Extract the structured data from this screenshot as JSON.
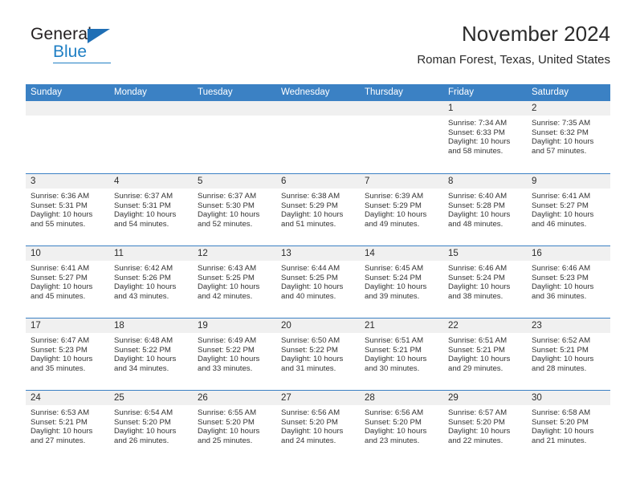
{
  "brand": {
    "name_top": "General",
    "name_bottom": "Blue",
    "accent_color": "#1f7fc4",
    "triangle_color": "#1f6fb5",
    "logo_icon": "triangle-logo-icon"
  },
  "header": {
    "title": "November 2024",
    "subtitle": "Roman Forest, Texas, United States"
  },
  "calendar": {
    "header_bg": "#3b81c4",
    "header_text_color": "#ffffff",
    "day_head_bg": "#f0f0f0",
    "weekdays": [
      "Sunday",
      "Monday",
      "Tuesday",
      "Wednesday",
      "Thursday",
      "Friday",
      "Saturday"
    ],
    "weeks": [
      [
        {
          "day": "",
          "lines": []
        },
        {
          "day": "",
          "lines": []
        },
        {
          "day": "",
          "lines": []
        },
        {
          "day": "",
          "lines": []
        },
        {
          "day": "",
          "lines": []
        },
        {
          "day": "1",
          "lines": [
            "Sunrise: 7:34 AM",
            "Sunset: 6:33 PM",
            "Daylight: 10 hours",
            "and 58 minutes."
          ]
        },
        {
          "day": "2",
          "lines": [
            "Sunrise: 7:35 AM",
            "Sunset: 6:32 PM",
            "Daylight: 10 hours",
            "and 57 minutes."
          ]
        }
      ],
      [
        {
          "day": "3",
          "lines": [
            "Sunrise: 6:36 AM",
            "Sunset: 5:31 PM",
            "Daylight: 10 hours",
            "and 55 minutes."
          ]
        },
        {
          "day": "4",
          "lines": [
            "Sunrise: 6:37 AM",
            "Sunset: 5:31 PM",
            "Daylight: 10 hours",
            "and 54 minutes."
          ]
        },
        {
          "day": "5",
          "lines": [
            "Sunrise: 6:37 AM",
            "Sunset: 5:30 PM",
            "Daylight: 10 hours",
            "and 52 minutes."
          ]
        },
        {
          "day": "6",
          "lines": [
            "Sunrise: 6:38 AM",
            "Sunset: 5:29 PM",
            "Daylight: 10 hours",
            "and 51 minutes."
          ]
        },
        {
          "day": "7",
          "lines": [
            "Sunrise: 6:39 AM",
            "Sunset: 5:29 PM",
            "Daylight: 10 hours",
            "and 49 minutes."
          ]
        },
        {
          "day": "8",
          "lines": [
            "Sunrise: 6:40 AM",
            "Sunset: 5:28 PM",
            "Daylight: 10 hours",
            "and 48 minutes."
          ]
        },
        {
          "day": "9",
          "lines": [
            "Sunrise: 6:41 AM",
            "Sunset: 5:27 PM",
            "Daylight: 10 hours",
            "and 46 minutes."
          ]
        }
      ],
      [
        {
          "day": "10",
          "lines": [
            "Sunrise: 6:41 AM",
            "Sunset: 5:27 PM",
            "Daylight: 10 hours",
            "and 45 minutes."
          ]
        },
        {
          "day": "11",
          "lines": [
            "Sunrise: 6:42 AM",
            "Sunset: 5:26 PM",
            "Daylight: 10 hours",
            "and 43 minutes."
          ]
        },
        {
          "day": "12",
          "lines": [
            "Sunrise: 6:43 AM",
            "Sunset: 5:25 PM",
            "Daylight: 10 hours",
            "and 42 minutes."
          ]
        },
        {
          "day": "13",
          "lines": [
            "Sunrise: 6:44 AM",
            "Sunset: 5:25 PM",
            "Daylight: 10 hours",
            "and 40 minutes."
          ]
        },
        {
          "day": "14",
          "lines": [
            "Sunrise: 6:45 AM",
            "Sunset: 5:24 PM",
            "Daylight: 10 hours",
            "and 39 minutes."
          ]
        },
        {
          "day": "15",
          "lines": [
            "Sunrise: 6:46 AM",
            "Sunset: 5:24 PM",
            "Daylight: 10 hours",
            "and 38 minutes."
          ]
        },
        {
          "day": "16",
          "lines": [
            "Sunrise: 6:46 AM",
            "Sunset: 5:23 PM",
            "Daylight: 10 hours",
            "and 36 minutes."
          ]
        }
      ],
      [
        {
          "day": "17",
          "lines": [
            "Sunrise: 6:47 AM",
            "Sunset: 5:23 PM",
            "Daylight: 10 hours",
            "and 35 minutes."
          ]
        },
        {
          "day": "18",
          "lines": [
            "Sunrise: 6:48 AM",
            "Sunset: 5:22 PM",
            "Daylight: 10 hours",
            "and 34 minutes."
          ]
        },
        {
          "day": "19",
          "lines": [
            "Sunrise: 6:49 AM",
            "Sunset: 5:22 PM",
            "Daylight: 10 hours",
            "and 33 minutes."
          ]
        },
        {
          "day": "20",
          "lines": [
            "Sunrise: 6:50 AM",
            "Sunset: 5:22 PM",
            "Daylight: 10 hours",
            "and 31 minutes."
          ]
        },
        {
          "day": "21",
          "lines": [
            "Sunrise: 6:51 AM",
            "Sunset: 5:21 PM",
            "Daylight: 10 hours",
            "and 30 minutes."
          ]
        },
        {
          "day": "22",
          "lines": [
            "Sunrise: 6:51 AM",
            "Sunset: 5:21 PM",
            "Daylight: 10 hours",
            "and 29 minutes."
          ]
        },
        {
          "day": "23",
          "lines": [
            "Sunrise: 6:52 AM",
            "Sunset: 5:21 PM",
            "Daylight: 10 hours",
            "and 28 minutes."
          ]
        }
      ],
      [
        {
          "day": "24",
          "lines": [
            "Sunrise: 6:53 AM",
            "Sunset: 5:21 PM",
            "Daylight: 10 hours",
            "and 27 minutes."
          ]
        },
        {
          "day": "25",
          "lines": [
            "Sunrise: 6:54 AM",
            "Sunset: 5:20 PM",
            "Daylight: 10 hours",
            "and 26 minutes."
          ]
        },
        {
          "day": "26",
          "lines": [
            "Sunrise: 6:55 AM",
            "Sunset: 5:20 PM",
            "Daylight: 10 hours",
            "and 25 minutes."
          ]
        },
        {
          "day": "27",
          "lines": [
            "Sunrise: 6:56 AM",
            "Sunset: 5:20 PM",
            "Daylight: 10 hours",
            "and 24 minutes."
          ]
        },
        {
          "day": "28",
          "lines": [
            "Sunrise: 6:56 AM",
            "Sunset: 5:20 PM",
            "Daylight: 10 hours",
            "and 23 minutes."
          ]
        },
        {
          "day": "29",
          "lines": [
            "Sunrise: 6:57 AM",
            "Sunset: 5:20 PM",
            "Daylight: 10 hours",
            "and 22 minutes."
          ]
        },
        {
          "day": "30",
          "lines": [
            "Sunrise: 6:58 AM",
            "Sunset: 5:20 PM",
            "Daylight: 10 hours",
            "and 21 minutes."
          ]
        }
      ]
    ]
  }
}
